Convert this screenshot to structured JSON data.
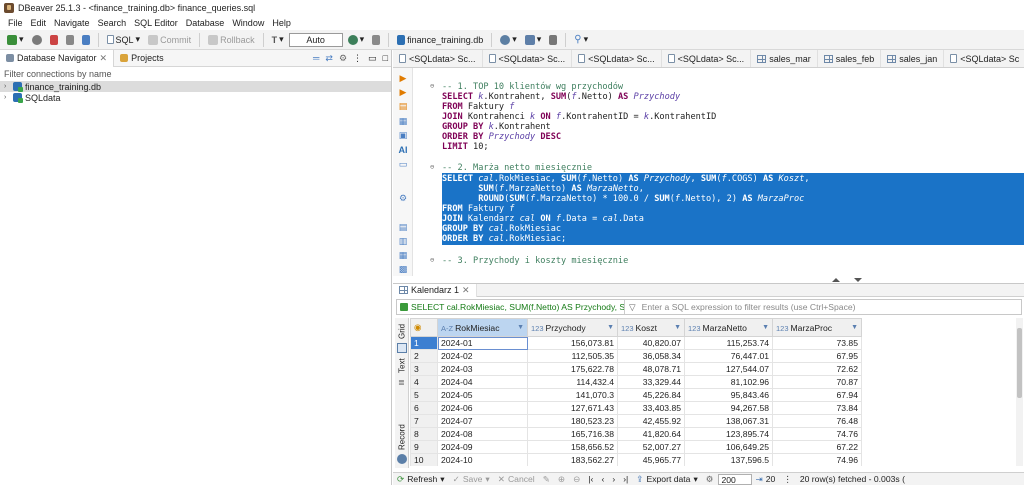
{
  "window": {
    "title": "DBeaver 25.1.3 - <finance_training.db> finance_queries.sql"
  },
  "menu": [
    "File",
    "Edit",
    "Navigate",
    "Search",
    "SQL Editor",
    "Database",
    "Window",
    "Help"
  ],
  "toolbar": {
    "sql_label": "SQL",
    "commit_label": "Commit",
    "rollback_label": "Rollback",
    "tx_mode": "Auto",
    "db_label": "finance_training.db"
  },
  "left_panel": {
    "tabs": [
      "Database Navigator",
      "Projects"
    ],
    "filter_placeholder": "Filter connections by name",
    "tree": [
      "finance_training.db",
      "SQLdata"
    ]
  },
  "editor_tabs": [
    "<SQLdata> Sc...",
    "<SQLdata> Sc...",
    "<SQLdata> Sc...",
    "<SQLdata> Sc...",
    "sales_mar",
    "sales_feb",
    "sales_jan",
    "<SQLdata> Sc"
  ],
  "code": {
    "q1_comment": "-- 1. TOP 10 klientów wg przychodów",
    "q2_comment": "-- 2. Marża netto miesięcznie",
    "q3_comment": "-- 3. Przychody i koszty miesięcznie"
  },
  "results": {
    "tab_label": "Kalendarz 1",
    "filter_query": "SELECT cal.RokMiesiac, SUM(f.Netto) AS Przychody, SUM(f",
    "filter_placeholder": "Enter a SQL expression to filter results (use Ctrl+Space)",
    "vertical_tabs": [
      "Grid",
      "Text",
      "Record"
    ],
    "columns": [
      {
        "type": "A-Z",
        "name": "RokMiesiac"
      },
      {
        "type": "123",
        "name": "Przychody"
      },
      {
        "type": "123",
        "name": "Koszt"
      },
      {
        "type": "123",
        "name": "MarzaNetto"
      },
      {
        "type": "123",
        "name": "MarzaProc"
      }
    ],
    "rows": [
      [
        "1",
        "2024-01",
        "156,073.81",
        "40,820.07",
        "115,253.74",
        "73.85"
      ],
      [
        "2",
        "2024-02",
        "112,505.35",
        "36,058.34",
        "76,447.01",
        "67.95"
      ],
      [
        "3",
        "2024-03",
        "175,622.78",
        "48,078.71",
        "127,544.07",
        "72.62"
      ],
      [
        "4",
        "2024-04",
        "114,432.4",
        "33,329.44",
        "81,102.96",
        "70.87"
      ],
      [
        "5",
        "2024-05",
        "141,070.3",
        "45,226.84",
        "95,843.46",
        "67.94"
      ],
      [
        "6",
        "2024-06",
        "127,671.43",
        "33,403.85",
        "94,267.58",
        "73.84"
      ],
      [
        "7",
        "2024-07",
        "180,523.23",
        "42,455.92",
        "138,067.31",
        "76.48"
      ],
      [
        "8",
        "2024-08",
        "165,716.38",
        "41,820.64",
        "123,895.74",
        "74.76"
      ],
      [
        "9",
        "2024-09",
        "158,656.52",
        "52,007.27",
        "106,649.25",
        "67.22"
      ],
      [
        "10",
        "2024-10",
        "183,562.27",
        "45,965.77",
        "137,596.5",
        "74.96"
      ]
    ]
  },
  "status": {
    "refresh_label": "Refresh",
    "save_label": "Save",
    "cancel_label": "Cancel",
    "export_label": "Export data",
    "fetch_size": "200",
    "rows_count": "20",
    "message": "20 row(s) fetched - 0.003s ("
  }
}
